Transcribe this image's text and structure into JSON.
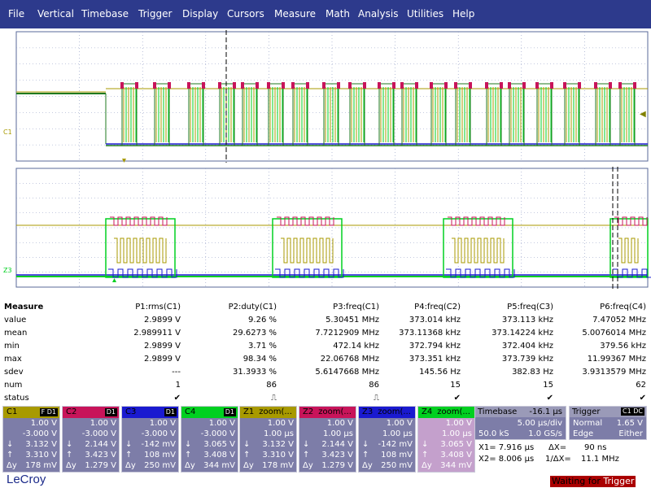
{
  "menu": [
    "File",
    "Vertical",
    "Timebase",
    "Trigger",
    "Display",
    "Cursors",
    "Measure",
    "Math",
    "Analysis",
    "Utilities",
    "Help"
  ],
  "colors": {
    "c1": "#a89a00",
    "c2": "#c8145a",
    "c3": "#1a1ad0",
    "c4": "#00d020",
    "dgreen": "#1f7a1f",
    "menubar": "#2d3a8c",
    "panel": "#7d7da8"
  },
  "markers": {
    "top_left": "C1",
    "bottom_left": "Z3"
  },
  "measure": {
    "title": "Measure",
    "headers": [
      "P1:rms(C1)",
      "P2:duty(C1)",
      "P3:freq(C1)",
      "P4:freq(C2)",
      "P5:freq(C3)",
      "P6:freq(C4)"
    ],
    "rows": [
      {
        "label": "value",
        "vals": [
          "2.9899 V",
          "9.26 %",
          "5.30451 MHz",
          "373.014 kHz",
          "373.113 kHz",
          "7.47052 MHz"
        ]
      },
      {
        "label": "mean",
        "vals": [
          "2.989911 V",
          "29.6273 %",
          "7.7212909 MHz",
          "373.11368 kHz",
          "373.14224 kHz",
          "5.0076014 MHz"
        ]
      },
      {
        "label": "min",
        "vals": [
          "2.9899 V",
          "3.71 %",
          "472.14 kHz",
          "372.794 kHz",
          "372.404 kHz",
          "379.56 kHz"
        ]
      },
      {
        "label": "max",
        "vals": [
          "2.9899 V",
          "98.34 %",
          "22.06768 MHz",
          "373.351 kHz",
          "373.739 kHz",
          "11.99367 MHz"
        ]
      },
      {
        "label": "sdev",
        "vals": [
          "---",
          "31.3933 %",
          "5.6147668 MHz",
          "145.56 Hz",
          "382.83 Hz",
          "3.9313579 MHz"
        ]
      },
      {
        "label": "num",
        "vals": [
          "1",
          "86",
          "86",
          "15",
          "15",
          "62"
        ]
      },
      {
        "label": "status",
        "vals": [
          "✔",
          "⎍",
          "⎍",
          "✔",
          "✔",
          "✔"
        ]
      }
    ]
  },
  "channels": [
    {
      "name": "C1",
      "tag": "F D1",
      "color": "#a89a00",
      "scale": "1.00 V",
      "offset": "-3.000 V",
      "a": "3.132 V",
      "b": "3.310 V",
      "d": "178 mV"
    },
    {
      "name": "C2",
      "tag": "D1",
      "color": "#c8145a",
      "scale": "1.00 V",
      "offset": "-3.000 V",
      "a": "2.144 V",
      "b": "3.423 V",
      "d": "1.279 V"
    },
    {
      "name": "C3",
      "tag": "D1",
      "color": "#1a1ad0",
      "scale": "1.00 V",
      "offset": "-3.000 V",
      "a": "-142 mV",
      "b": "108 mV",
      "d": "250 mV"
    },
    {
      "name": "C4",
      "tag": "D1",
      "color": "#00d020",
      "scale": "1.00 V",
      "offset": "-3.000 V",
      "a": "3.065 V",
      "b": "3.408 V",
      "d": "344 mV"
    }
  ],
  "zooms": [
    {
      "name": "Z1",
      "title": "zoom(...",
      "color": "#a89a00",
      "scale": "1.00 V",
      "time": "1.00 µs",
      "a": "3.132 V",
      "b": "3.310 V",
      "d": "178 mV"
    },
    {
      "name": "Z2",
      "title": "zoom(...",
      "color": "#c8145a",
      "scale": "1.00 V",
      "time": "1.00 µs",
      "a": "2.144 V",
      "b": "3.423 V",
      "d": "1.279 V"
    },
    {
      "name": "Z3",
      "title": "zoom(...",
      "color": "#1a1ad0",
      "scale": "1.00 V",
      "time": "1.00 µs",
      "a": "-142 mV",
      "b": "108 mV",
      "d": "250 mV"
    },
    {
      "name": "Z4",
      "title": "zoom(...",
      "color": "#00d020",
      "scale": "1.00 V",
      "time": "1.00 µs",
      "a": "3.065 V",
      "b": "3.408 V",
      "d": "344 mV"
    }
  ],
  "timebase": {
    "label": "Timebase",
    "delay": "-16.1 µs",
    "div": "5.00 µs/div",
    "samples": "50.0 kS",
    "rate": "1.0 GS/s"
  },
  "trigger": {
    "label": "Trigger",
    "tag": "C1 DC",
    "mode": "Normal",
    "level": "1.65 V",
    "type": "Edge",
    "slope": "Either"
  },
  "cursors": {
    "x1": "X1= 7.916 µs",
    "dx": "ΔX=",
    "dxv": "90 ns",
    "x2": "X2= 8.006 µs",
    "idx": "1/ΔX=",
    "idxv": "11.1 MHz"
  },
  "brand": "LeCroy",
  "status": {
    "text1": "Waiting for ",
    "text2": "Trigger"
  }
}
